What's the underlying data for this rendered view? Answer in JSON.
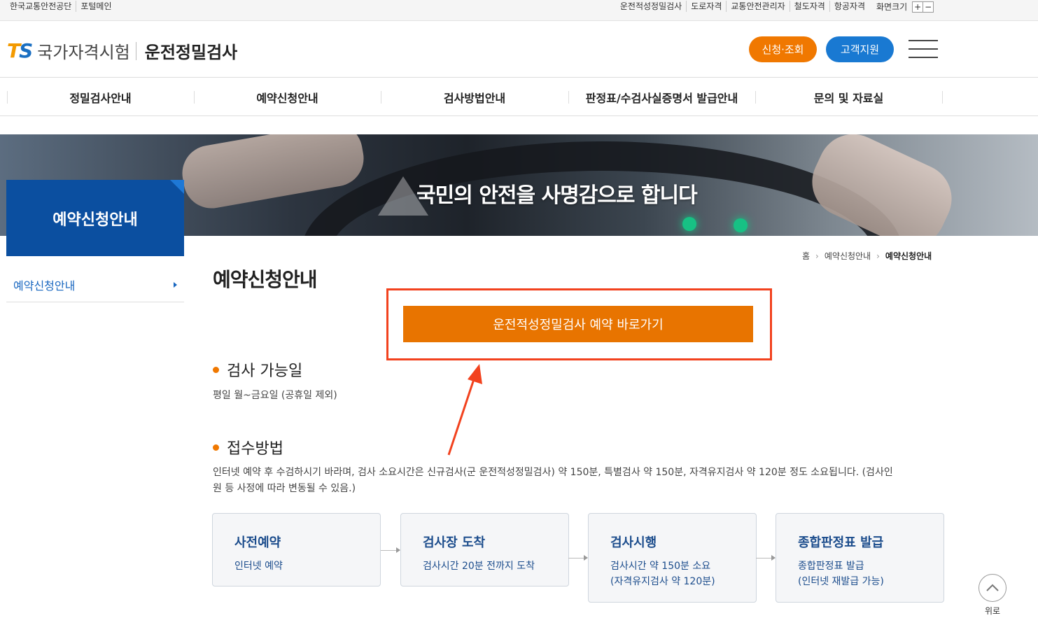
{
  "topbar": {
    "left": [
      "한국교통안전공단",
      "포털메인"
    ],
    "right": [
      "운전적성정밀검사",
      "도로자격",
      "교통안전관리자",
      "철도자격",
      "항공자격"
    ],
    "fontsize_label": "화면크기",
    "plus": "+",
    "minus": "−"
  },
  "header": {
    "logo_t": "T",
    "logo_s": "S",
    "org": "국가자격시험",
    "service": "운전정밀검사",
    "apply_label": "신청·조회",
    "support_label": "고객지원"
  },
  "gnb": [
    "정밀검사안내",
    "예약신청안내",
    "검사방법안내",
    "판정표/수검사실증명서 발급안내",
    "문의 및 자료실"
  ],
  "banner": {
    "slogan": "국민의 안전을 사명감으로 합니다"
  },
  "sidebar": {
    "title": "예약신청안내",
    "items": [
      {
        "label": "예약신청안내"
      }
    ]
  },
  "breadcrumb": [
    "홈",
    "예약신청안내",
    "예약신청안내"
  ],
  "content": {
    "title": "예약신청안내",
    "reserve_button": "운전적성정밀검사 예약 바로가기",
    "section1_title": "검사 가능일",
    "section1_desc": "평일 월~금요일 (공휴일 제외)",
    "section2_title": "접수방법",
    "section2_desc_line1": "인터넷 예약 후 수검하시기 바라며, 검사 소요시간은 신규검사(군 운전적성정밀검사) 약 150분, 특별검사 약 150분, 자격유지검사 약 120분 정도 소요됩니다. (검사인",
    "section2_desc_line2": "원 등 사정에 따라 변동될 수 있음.)"
  },
  "steps": [
    {
      "title": "사전예약",
      "lines": [
        "인터넷 예약"
      ]
    },
    {
      "title": "검사장 도착",
      "lines": [
        "검사시간 20분 전까지 도착"
      ]
    },
    {
      "title": "검사시행",
      "lines": [
        "검사시간 약 150분 소요",
        "(자격유지검사 약 120분)"
      ]
    },
    {
      "title": "종합판정표 발급",
      "lines": [
        "종합판정표 발급",
        "(인터넷 재발급 가능)"
      ]
    }
  ],
  "to_top": {
    "label": "위로"
  },
  "colors": {
    "accent_orange": "#e87400",
    "brand_blue": "#0b4fa0",
    "highlight_red": "#f2421e"
  }
}
